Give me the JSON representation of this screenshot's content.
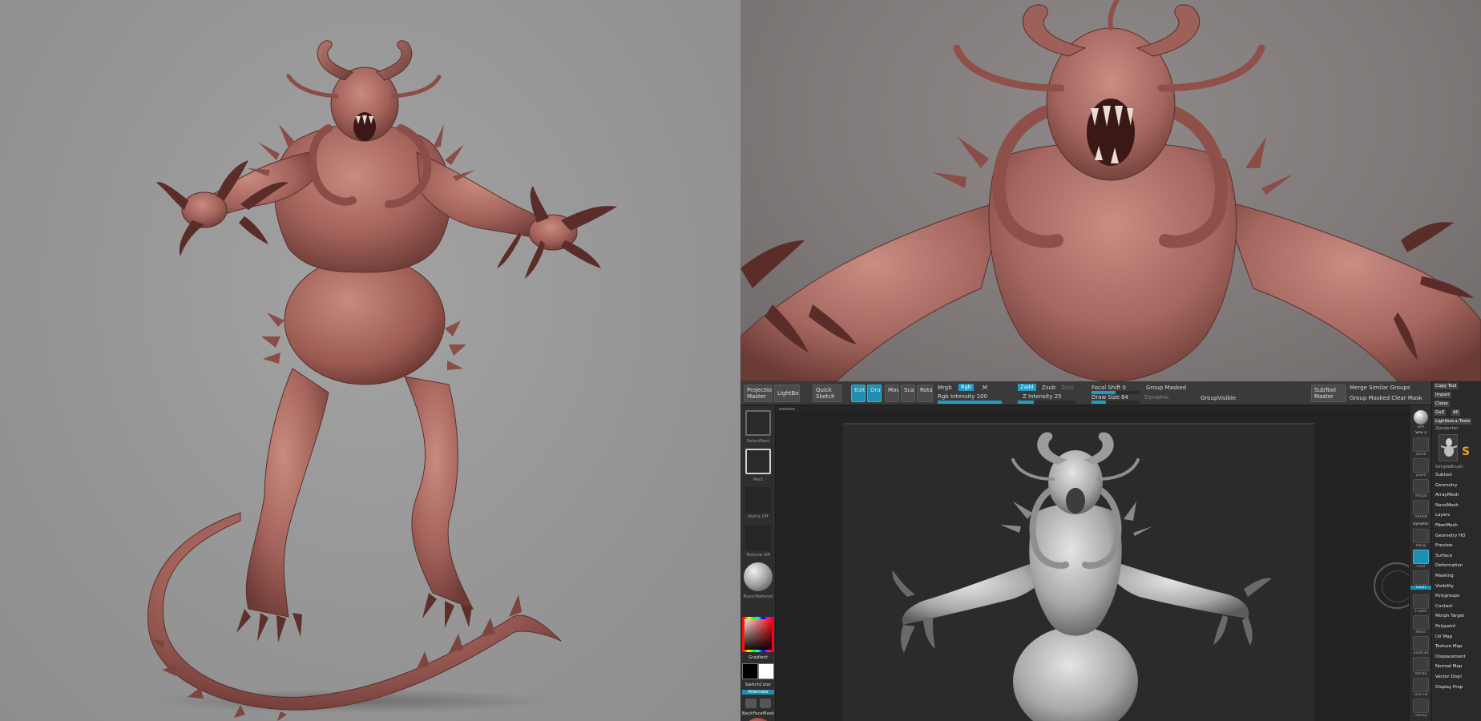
{
  "zbrush": {
    "topbar": {
      "projection_master": "Projection Master",
      "lightbox": "LightBox",
      "quick_sketch": "Quick Sketch",
      "edit": "Edit",
      "draw": "Draw",
      "move": "Move",
      "scale": "Scale",
      "rotate": "Rotate",
      "mrgb": "Mrgb",
      "rgb": "Rgb",
      "m": "M",
      "rgb_intensity": "Rgb Intensity 100",
      "zadd": "Zadd",
      "zsub": "Zsub",
      "zcut": "Zcut",
      "z_intensity": "Z Intensity 25",
      "focal_shift": "Focal Shift 0",
      "draw_size": "Draw Size 64",
      "dynamic": "Dynamic",
      "group_masked": "Group Masked",
      "groupvisible": "GroupVisible",
      "subtool_master": "SubTool Master",
      "merge_similar_groups": "Merge Similar Groups",
      "group_masked_clear_mask": "Group Masked Clear Mask"
    },
    "leftshelf": {
      "label_selected": "SelectRect",
      "label_rect": "Rect",
      "label_alpha": "Alpha Off",
      "label_texture": "Texture Off",
      "label_material": "BasicMaterial",
      "label_gradient": "Gradient",
      "label_switchcolor": "SwitchColor",
      "label_alternate": "Alternate",
      "label_backface": "BackFaceMask"
    },
    "rightshelf": {
      "bpr": "BPR",
      "spix": "SPix 3",
      "scroll": "Scroll",
      "zoom": "Zoom",
      "actual": "Actual",
      "aahalf": "AAHalf",
      "dynamic": "Dynamic",
      "persp": "Persp",
      "floor": "Floor",
      "local": "Local",
      "frame": "Frame",
      "move": "Move",
      "zoom3d": "Zoom3D",
      "rotate": "Rotate",
      "linefill": "Line Fill",
      "transp": "Transp"
    },
    "tray": {
      "copy_tool": "Copy Tool",
      "import": "Import",
      "clone": "Clone",
      "goz": "GoZ",
      "all": "All",
      "lightbox_tools": "Lightbox ▸ Tools",
      "zprojector": "Zprojector",
      "simplebrush": "SimpleBrush",
      "items": [
        "Subtool",
        "Geometry",
        "ArrayMesh",
        "NanoMesh",
        "Layers",
        "FiberMesh",
        "Geometry HD",
        "Preview",
        "Surface",
        "Deformation",
        "Masking",
        "Visibility",
        "Polygroups",
        "Contact",
        "Morph Target",
        "Polypaint",
        "UV Map",
        "Texture Map",
        "Displacement",
        "Normal Map",
        "Vector Displ",
        "Display Prop"
      ]
    },
    "colors": {
      "accent": "#1e9cc4",
      "panel": "#2e2e2e",
      "canvas": "#2b2b2b",
      "skin": "#b9766e"
    }
  }
}
